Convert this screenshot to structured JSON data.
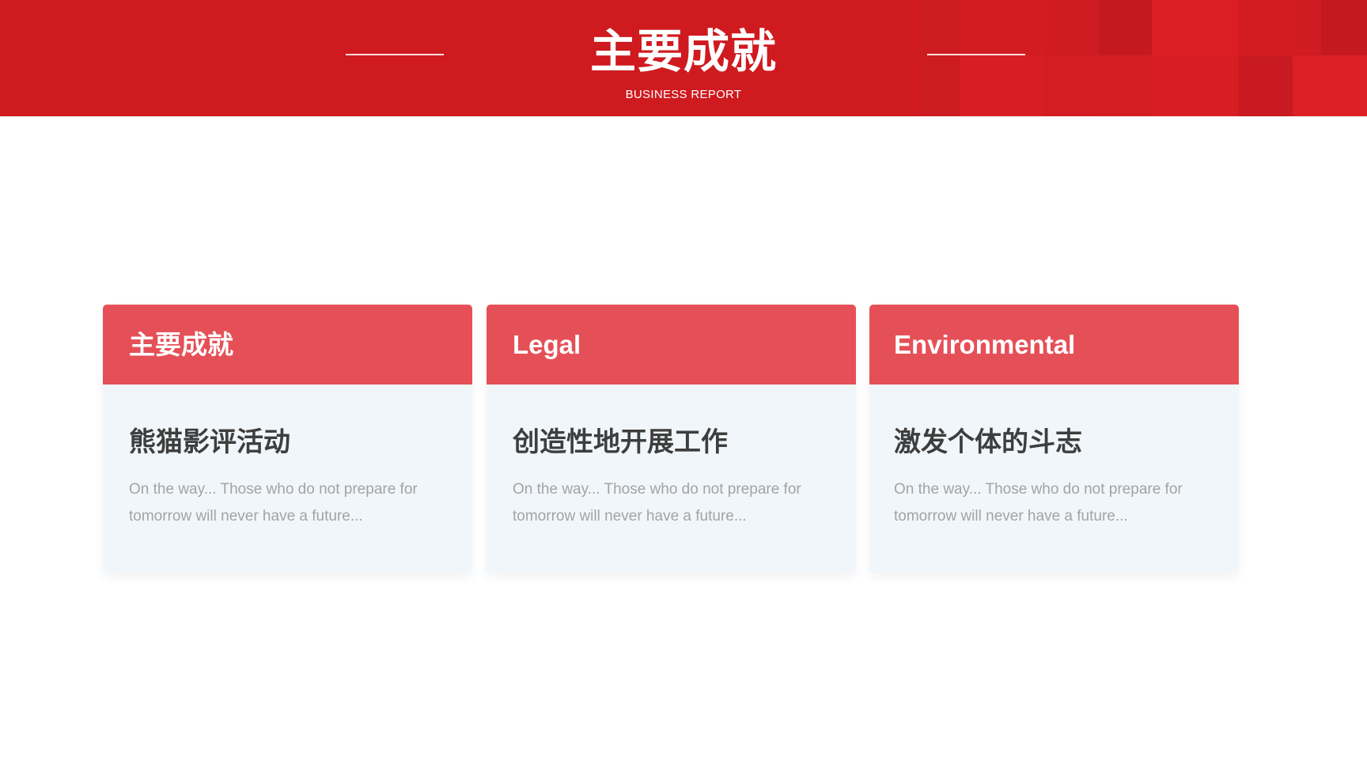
{
  "header": {
    "title": "主要成就",
    "subtitle": "BUSINESS REPORT"
  },
  "cards": [
    {
      "heading": "主要成就",
      "title": "熊猫影评活动",
      "description": "On the way... Those who do not prepare for tomorrow will never have a future..."
    },
    {
      "heading": "Legal",
      "title": "创造性地开展工作",
      "description": "On the way... Those who do not prepare for tomorrow will never have a future..."
    },
    {
      "heading": "Environmental",
      "title": "激发个体的斗志",
      "description": "On the way... Those who do not prepare for tomorrow will never have a future..."
    }
  ],
  "colors": {
    "header_bg": "#cf1a1f",
    "card_head_bg": "#e55058",
    "card_body_bg": "#f1f6fa",
    "card_title": "#3e3e3e",
    "card_desc": "#a3a3a3"
  }
}
